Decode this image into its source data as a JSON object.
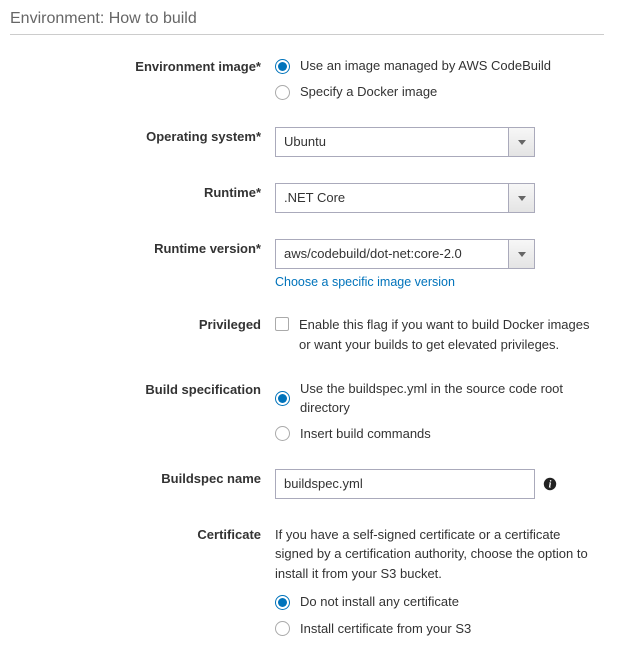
{
  "section_title": "Environment: How to build",
  "fields": {
    "environment_image": {
      "label": "Environment image*",
      "options": [
        "Use an image managed by AWS CodeBuild",
        "Specify a Docker image"
      ]
    },
    "operating_system": {
      "label": "Operating system*",
      "value": "Ubuntu"
    },
    "runtime": {
      "label": "Runtime*",
      "value": ".NET Core"
    },
    "runtime_version": {
      "label": "Runtime version*",
      "value": "aws/codebuild/dot-net:core-2.0",
      "link": "Choose a specific image version"
    },
    "privileged": {
      "label": "Privileged",
      "checkbox_text": "Enable this flag if you want to build Docker images or want your builds to get elevated privileges."
    },
    "build_spec": {
      "label": "Build specification",
      "options": [
        "Use the buildspec.yml in the source code root directory",
        "Insert build commands"
      ]
    },
    "buildspec_name": {
      "label": "Buildspec name",
      "value": "buildspec.yml"
    },
    "certificate": {
      "label": "Certificate",
      "help": "If you have a self-signed certificate or a certificate signed by a certification authority, choose the option to install it from your S3 bucket.",
      "options": [
        "Do not install any certificate",
        "Install certificate from your S3"
      ]
    }
  }
}
